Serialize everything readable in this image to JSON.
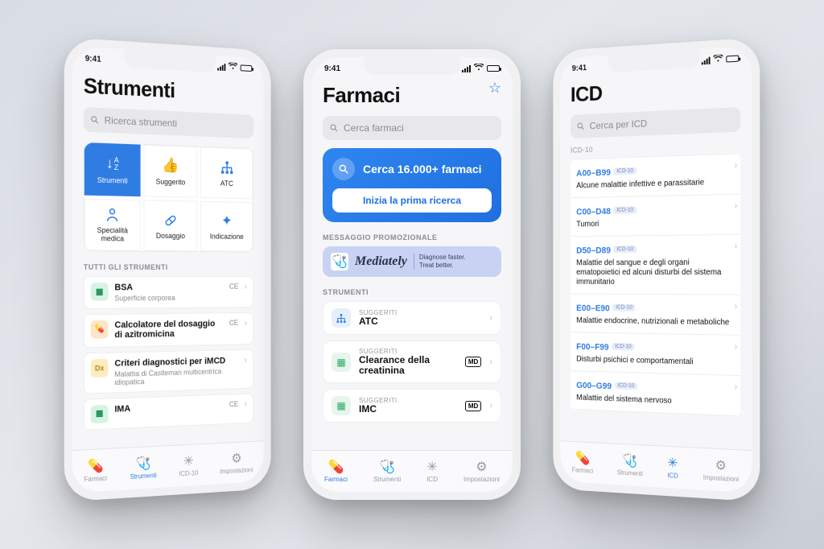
{
  "status": {
    "time": "9:41"
  },
  "tabs": {
    "farmaci": "Farmaci",
    "strumenti": "Strumenti",
    "icd10": "ICD-10",
    "icd": "ICD",
    "impostazioni": "Impostazioni"
  },
  "strumenti": {
    "title": "Strumenti",
    "search_placeholder": "Ricerca strumenti",
    "tiles": [
      {
        "label": "Strumenti",
        "icon": "sort-az"
      },
      {
        "label": "Suggerito",
        "icon": "thumbs-up"
      },
      {
        "label": "ATC",
        "icon": "tree"
      },
      {
        "label": "Specialità medica",
        "icon": "doctor"
      },
      {
        "label": "Dosaggio",
        "icon": "pill"
      },
      {
        "label": "Indicazione",
        "icon": "sparkle"
      }
    ],
    "all_label": "TUTTI GLI STRUMENTI",
    "list": [
      {
        "title": "BSA",
        "sub": "Superficie corporea",
        "ce": "CE",
        "color": "#29b36a",
        "badge": "⬚"
      },
      {
        "title": "Calcolatore del dosaggio di azitromicina",
        "sub": "",
        "ce": "CE",
        "color": "#f59a2d",
        "badge": "💊"
      },
      {
        "title": "Criteri diagnostici per iMCD",
        "sub": "Malattia di Castleman multicentrica idiopatica",
        "ce": "",
        "color": "#f6c24a",
        "badge": "Dx"
      },
      {
        "title": "IMA",
        "sub": "",
        "ce": "CE",
        "color": "#29b36a",
        "badge": "⬚"
      }
    ]
  },
  "farmaci": {
    "title": "Farmaci",
    "search_placeholder": "Cerca farmaci",
    "hero_text": "Cerca 16.000+ farmaci",
    "hero_button": "Inizia la prima ricerca",
    "promo_label": "MESSAGGIO PROMOZIONALE",
    "promo_brand": "Mediately",
    "promo_tag1": "Diagnose faster.",
    "promo_tag2": "Treat better.",
    "strumenti_label": "STRUMENTI",
    "items": [
      {
        "sug": "SUGGERITI",
        "name": "ATC",
        "md": false,
        "blue": true
      },
      {
        "sug": "SUGGERITI",
        "name": "Clearance della creatinina",
        "md": true,
        "blue": false
      },
      {
        "sug": "SUGGERITI",
        "name": "IMC",
        "md": true,
        "blue": false
      }
    ]
  },
  "icd": {
    "title": "ICD",
    "search_placeholder": "Cerca per ICD",
    "section": "ICD-10",
    "tag": "ICD-10",
    "rows": [
      {
        "code": "A00–B99",
        "desc": "Alcune malattie infettive e parassitarie"
      },
      {
        "code": "C00–D48",
        "desc": "Tumori"
      },
      {
        "code": "D50–D89",
        "desc": "Malattie del sangue e degli organi ematopoietici ed alcuni disturbi del sistema immunitario"
      },
      {
        "code": "E00–E90",
        "desc": "Malattie endocrine, nutrizionali e metaboliche"
      },
      {
        "code": "F00–F99",
        "desc": "Disturbi psichici e comportamentali"
      },
      {
        "code": "G00–G99",
        "desc": "Malattie del sistema nervoso"
      }
    ]
  }
}
